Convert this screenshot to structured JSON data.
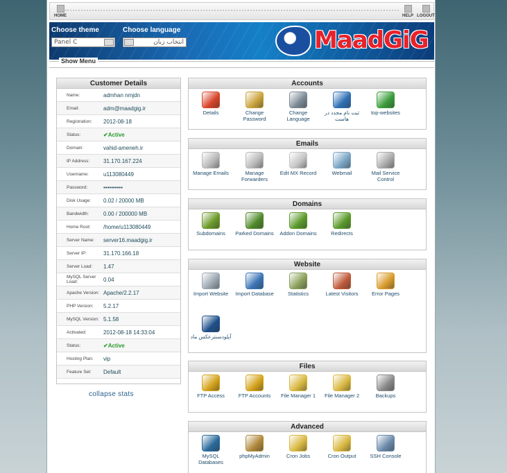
{
  "topnav": {
    "home": "HOME",
    "help": "HELP",
    "logout": "LOGOUT"
  },
  "banner": {
    "theme_label": "Choose theme",
    "theme_value": "Panel C",
    "language_label": "Choose language",
    "language_value": "انتخاب زبان",
    "logo_text": "MaadGiG"
  },
  "show_menu": "Show Menu",
  "customer": {
    "title": "Customer Details",
    "rows": [
      {
        "k": "Name:",
        "v": "admhan nmjdn"
      },
      {
        "k": "Email:",
        "v": "adm@maadgig.ir"
      },
      {
        "k": "Registration:",
        "v": "2012-08-18"
      },
      {
        "k": "Status:",
        "v": "Active",
        "active": true
      },
      {
        "k": "Domain:",
        "v": "vahid-ameneh.ir"
      },
      {
        "k": "IP Address:",
        "v": "31.170.167.224"
      },
      {
        "k": "Username:",
        "v": "u113080449"
      },
      {
        "k": "Password:",
        "v": "••••••••••"
      },
      {
        "k": "Disk Usage:",
        "v": "0.02 / 20000 MB"
      },
      {
        "k": "Bandwidth:",
        "v": "0.00 / 200000 MB"
      },
      {
        "k": "Home Root:",
        "v": "/home/u113080449"
      },
      {
        "k": "Server Name:",
        "v": "server16.maadgig.ir"
      },
      {
        "k": "Server IP:",
        "v": "31.170.166.18"
      },
      {
        "k": "Server Load:",
        "v": "1.47"
      },
      {
        "k": "MySQL Server Load:",
        "v": "0.04"
      },
      {
        "k": "Apache Version:",
        "v": "Apache/2.2.17"
      },
      {
        "k": "PHP Version:",
        "v": "5.2.17"
      },
      {
        "k": "MySQL Version:",
        "v": "5.1.58"
      },
      {
        "k": "Activated:",
        "v": "2012-08-18 14:33:04"
      },
      {
        "k": "Status:",
        "v": "Active",
        "active": true
      },
      {
        "k": "Hosting Plan:",
        "v": "vip"
      },
      {
        "k": "Feature Set:",
        "v": "Default"
      }
    ],
    "collapse": "collapse stats"
  },
  "panels": [
    {
      "title": "Accounts",
      "items": [
        {
          "label": "Details",
          "icon": "user-details-icon",
          "color": "#d8452a"
        },
        {
          "label": "Change Password",
          "icon": "password-icon",
          "color": "#c9a23a"
        },
        {
          "label": "Change Language",
          "icon": "language-icon",
          "color": "#7d8a96"
        },
        {
          "label": "ثبت نام مجدد در هاست",
          "icon": "register-icon",
          "color": "#2f6fb5"
        },
        {
          "label": "top-websites",
          "icon": "bar-chart-icon",
          "color": "#3a9d3a"
        }
      ]
    },
    {
      "title": "Emails",
      "items": [
        {
          "label": "Manage Emails",
          "icon": "envelope-gear-icon",
          "color": "#b8b8b8"
        },
        {
          "label": "Manage Forwarders",
          "icon": "envelope-forward-icon",
          "color": "#b8b8b8"
        },
        {
          "label": "Edit MX Record",
          "icon": "envelope-edit-icon",
          "color": "#c4c4c4"
        },
        {
          "label": "Webmail",
          "icon": "webmail-icon",
          "color": "#7aa4c4"
        },
        {
          "label": "Mail Service Control",
          "icon": "mail-control-icon",
          "color": "#a9a9a9"
        }
      ]
    },
    {
      "title": "Domains",
      "items": [
        {
          "label": "Subdomains",
          "icon": "www-sub-icon",
          "color": "#6b9a2a"
        },
        {
          "label": "Parked Domains",
          "icon": "www-parked-icon",
          "color": "#4f8a2a"
        },
        {
          "label": "Addon Domains",
          "icon": "www-addon-icon",
          "color": "#5a9a2a"
        },
        {
          "label": "Redirects",
          "icon": "www-redirect-icon",
          "color": "#5a9a2a"
        }
      ]
    },
    {
      "title": "Website",
      "items": [
        {
          "label": "Import Website",
          "icon": "import-website-icon",
          "color": "#9aa6b0"
        },
        {
          "label": "Import Database",
          "icon": "import-database-icon",
          "color": "#3a74b5"
        },
        {
          "label": "Statistics",
          "icon": "statistics-icon",
          "color": "#8aa05a"
        },
        {
          "label": "Latest Visitors",
          "icon": "visitors-icon",
          "color": "#c05a3a"
        },
        {
          "label": "Error Pages",
          "icon": "error-pages-icon",
          "color": "#d89a2a"
        },
        {
          "label": "آپلودسنترعکس ماد",
          "icon": "globe-upload-icon",
          "color": "#1e4f8a"
        }
      ]
    },
    {
      "title": "Files",
      "items": [
        {
          "label": "FTP Access",
          "icon": "ftp-access-icon",
          "color": "#d4a21a"
        },
        {
          "label": "FTP Accounts",
          "icon": "ftp-accounts-icon",
          "color": "#d4a21a"
        },
        {
          "label": "File Manager 1",
          "icon": "file-manager-icon",
          "color": "#d9b840"
        },
        {
          "label": "File Manager 2",
          "icon": "file-manager-2-icon",
          "color": "#d9b840"
        },
        {
          "label": "Backups",
          "icon": "backups-icon",
          "color": "#8a8a8a"
        }
      ]
    },
    {
      "title": "Advanced",
      "items": [
        {
          "label": "MySQL Databases",
          "icon": "mysql-icon",
          "color": "#2a6a9a"
        },
        {
          "label": "phpMyAdmin",
          "icon": "phpmyadmin-icon",
          "color": "#b0883a"
        },
        {
          "label": "Cron Jobs",
          "icon": "cron-jobs-icon",
          "color": "#d9b840"
        },
        {
          "label": "Cron Output",
          "icon": "cron-output-icon",
          "color": "#d9b840"
        },
        {
          "label": "SSH Console",
          "icon": "ssh-console-icon",
          "color": "#6a8aaa"
        }
      ]
    }
  ]
}
